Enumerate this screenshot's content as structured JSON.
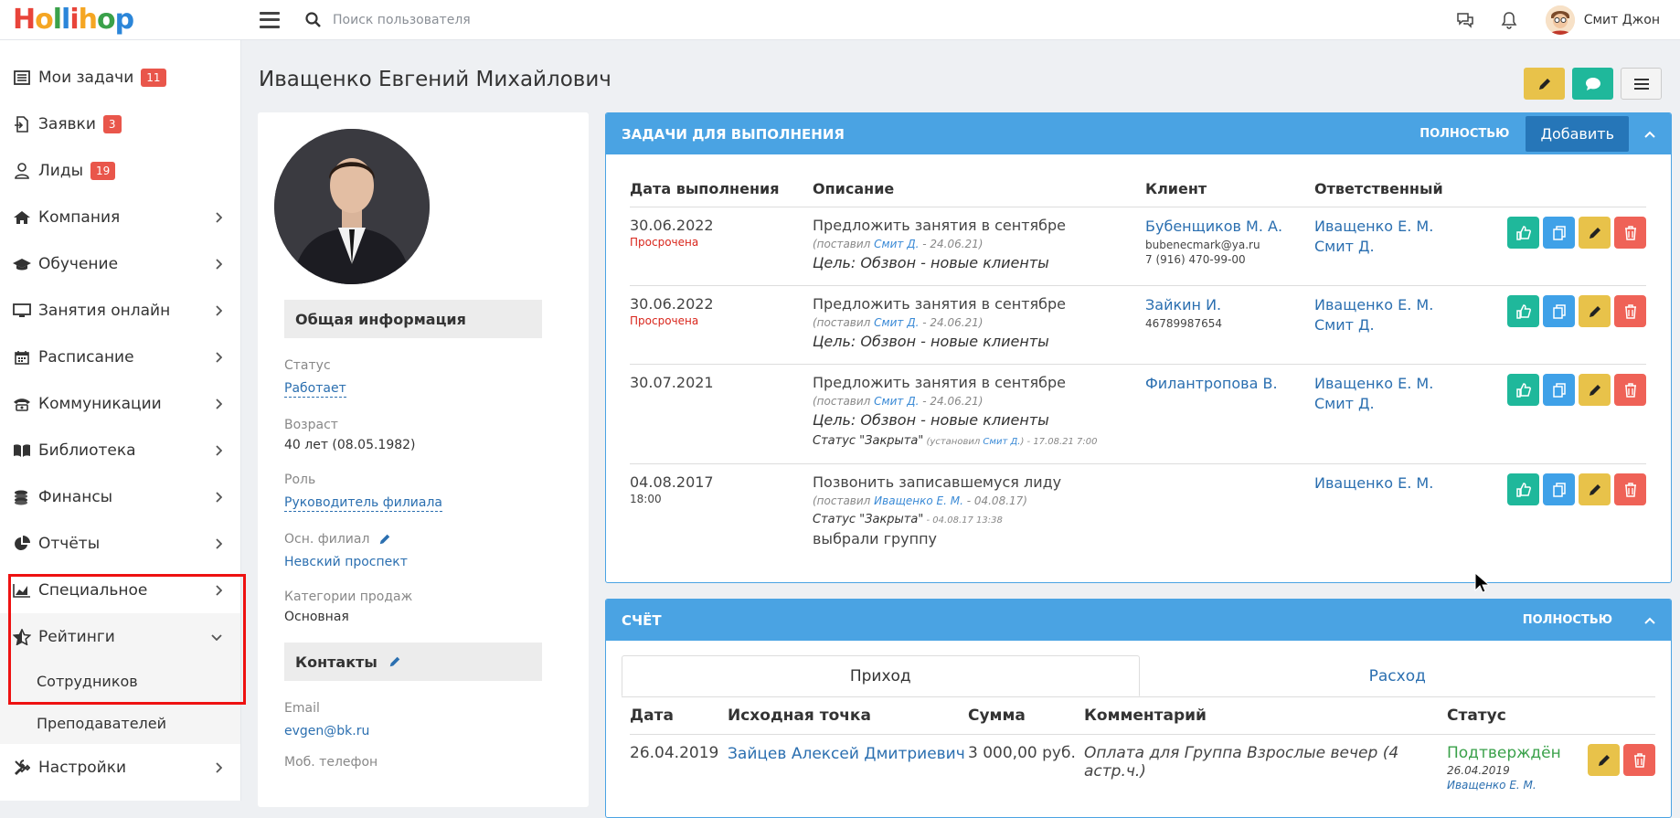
{
  "topbar": {
    "logo": "Hollihop",
    "search_placeholder": "Поиск пользователя",
    "user_name": "Смит Джон"
  },
  "sidebar": {
    "items": [
      {
        "label": "Мои задачи",
        "badge": "11",
        "icon": "list-icon"
      },
      {
        "label": "Заявки",
        "badge": "3",
        "icon": "document-icon"
      },
      {
        "label": "Лиды",
        "badge": "19",
        "icon": "user-icon"
      },
      {
        "label": "Компания",
        "icon": "home-icon"
      },
      {
        "label": "Обучение",
        "icon": "graduation-cap-icon"
      },
      {
        "label": "Занятия онлайн",
        "icon": "monitor-icon"
      },
      {
        "label": "Расписание",
        "icon": "calendar-icon"
      },
      {
        "label": "Коммуникации",
        "icon": "phone-icon"
      },
      {
        "label": "Библиотека",
        "icon": "book-icon"
      },
      {
        "label": "Финансы",
        "icon": "coins-icon"
      },
      {
        "label": "Отчёты",
        "icon": "pie-chart-icon"
      },
      {
        "label": "Специальное",
        "icon": "area-chart-icon"
      }
    ],
    "ratings": {
      "label": "Рейтинги",
      "sub": [
        "Сотрудников",
        "Преподавателей"
      ]
    },
    "settings": "Настройки"
  },
  "page": {
    "title": "Иващенко Евгений Михайлович"
  },
  "profile": {
    "general_header": "Общая информация",
    "status_label": "Статус",
    "status_value": "Работает",
    "age_label": "Возраст",
    "age_value": "40 лет (08.05.1982)",
    "role_label": "Роль",
    "role_value": "Руководитель филиала",
    "branch_label": "Осн. филиал",
    "branch_value": "Невский проспект",
    "sales_label": "Категории продаж",
    "sales_value": "Основная",
    "contacts_header": "Контакты",
    "email_label": "Email",
    "email_value": "evgen@bk.ru",
    "phone_label": "Моб. телефон"
  },
  "tasks": {
    "title": "ЗАДАЧИ ДЛЯ ВЫПОЛНЕНИЯ",
    "full": "ПОЛНОСТЬЮ",
    "add": "Добавить",
    "columns": [
      "Дата выполнения",
      "Описание",
      "Клиент",
      "Ответственный"
    ],
    "rows": [
      {
        "date": "30.06.2022",
        "date_note": "Просрочена",
        "desc": "Предложить занятия в сентябре",
        "meta_pre": "(поставил ",
        "meta_link": "Смит Д.",
        "meta_post": " - 24.06.21)",
        "goal": "Цель: Обзвон - новые клиенты",
        "client": "Бубенщиков М. А.",
        "client_email": "bubenecmark@ya.ru",
        "client_phone": "7 (916) 470-99-00",
        "resp1": "Иващенко Е. М.",
        "resp2": "Смит Д."
      },
      {
        "date": "30.06.2022",
        "date_note": "Просрочена",
        "desc": "Предложить занятия в сентябре",
        "meta_pre": "(поставил ",
        "meta_link": "Смит Д.",
        "meta_post": " - 24.06.21)",
        "goal": "Цель: Обзвон - новые клиенты",
        "client": "Зайкин И.",
        "client_phone": "46789987654",
        "resp1": "Иващенко Е. М.",
        "resp2": "Смит Д."
      },
      {
        "date": "30.07.2021",
        "desc": "Предложить занятия в сентябре",
        "meta_pre": "(поставил ",
        "meta_link": "Смит Д.",
        "meta_post": " - 24.06.21)",
        "goal": "Цель: Обзвон - новые клиенты",
        "status_text": "Статус \"Закрыта\"",
        "status_pre": " (установил ",
        "status_link": "Смит Д.",
        "status_post": ") - 17.08.21 7:00",
        "client": "Филантропова В.",
        "resp1": "Иващенко Е. М.",
        "resp2": "Смит Д."
      },
      {
        "date": "04.08.2017",
        "time": "18:00",
        "desc": "Позвонить записавшемуся лиду",
        "meta_pre": "(поставил ",
        "meta_link": "Иващенко Е. М.",
        "meta_post": " - 04.08.17)",
        "status_text": "Статус \"Закрыта\"",
        "status_post": " - 04.08.17 13:38",
        "note": "выбрали группу",
        "resp1": "Иващенко Е. М."
      }
    ]
  },
  "invoice": {
    "title": "СЧЁТ",
    "full": "ПОЛНОСТЬЮ",
    "tab_income": "Приход",
    "tab_expense": "Расход",
    "columns": [
      "Дата",
      "Исходная точка",
      "Сумма",
      "Комментарий",
      "Статус"
    ],
    "row": {
      "date": "26.04.2019",
      "source": "Зайцев Алексей Дмитриевич",
      "amount": "3 000,00 руб.",
      "comment": "Оплата для Группа Взрослые вечер (4 астр.ч.)",
      "status": "Подтверждён",
      "status_date": "26.04.2019",
      "status_by": "Иващенко Е. М."
    }
  }
}
